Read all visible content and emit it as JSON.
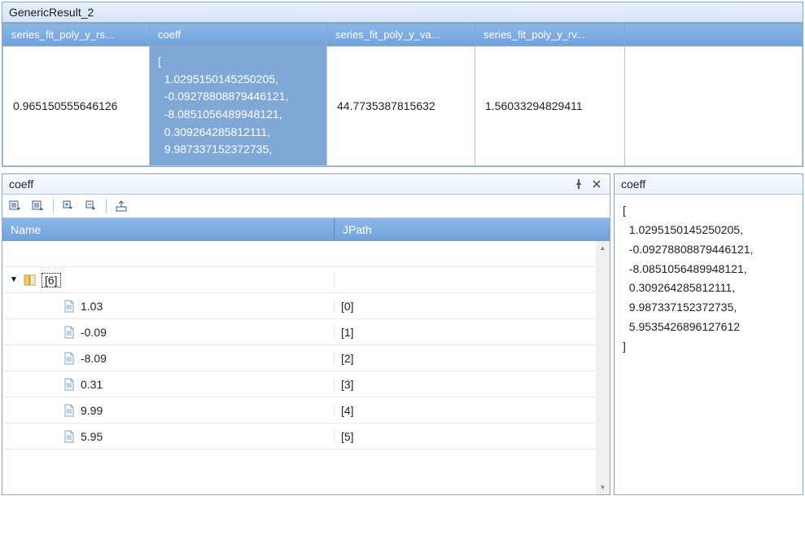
{
  "top_panel": {
    "title": "GenericResult_2",
    "columns": [
      "series_fit_poly_y_rs...",
      "coeff",
      "series_fit_poly_y_va...",
      "series_fit_poly_y_rv..."
    ],
    "row": {
      "rs": "0.965150555646126",
      "coeff_text": "[\n  1.0295150145250205,\n  -0.09278808879446121,\n  -8.0851056489948121,\n  0.309264285812111,\n  9.987337152372735,",
      "va": "44.7735387815632",
      "rv": "1.56033294829411"
    }
  },
  "tree_panel": {
    "title": "coeff",
    "header_name": "Name",
    "header_jpath": "JPath",
    "root_label": "[6]",
    "items": [
      {
        "value": "1.03",
        "jpath": "[0]"
      },
      {
        "value": "-0.09",
        "jpath": "[1]"
      },
      {
        "value": "-8.09",
        "jpath": "[2]"
      },
      {
        "value": "0.31",
        "jpath": "[3]"
      },
      {
        "value": "9.99",
        "jpath": "[4]"
      },
      {
        "value": "5.95",
        "jpath": "[5]"
      }
    ]
  },
  "text_panel": {
    "title": "coeff",
    "content": "[\n  1.0295150145250205,\n  -0.09278808879446121,\n  -8.0851056489948121,\n  0.309264285812111,\n  9.987337152372735,\n  5.9535426896127612\n]"
  }
}
